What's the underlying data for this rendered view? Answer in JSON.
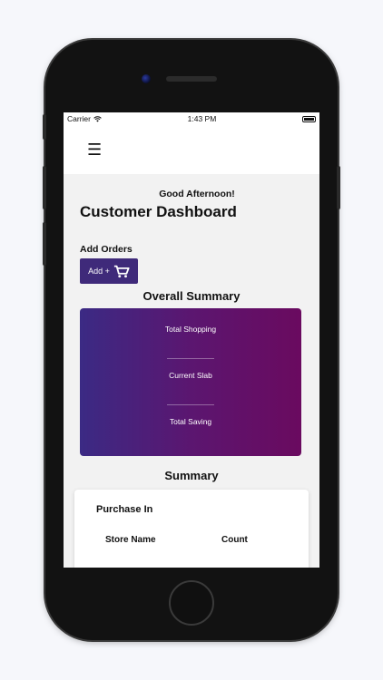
{
  "status_bar": {
    "carrier": "Carrier",
    "time": "1:43 PM"
  },
  "app_bar": {
    "menu_icon": "hamburger-icon"
  },
  "header": {
    "greeting": "Good Afternoon!",
    "title": "Customer Dashboard"
  },
  "orders": {
    "label": "Add Orders",
    "button_label": "Add +",
    "button_icon": "cart-icon"
  },
  "overall_summary": {
    "title": "Overall Summary",
    "metrics": [
      "Total Shopping",
      "Current Slab",
      "Total Saving"
    ],
    "gradient": [
      "#3b2a84",
      "#6a0a5f"
    ]
  },
  "summary": {
    "title": "Summary",
    "panel_title": "Purchase In",
    "columns": [
      "Store Name",
      "Count"
    ]
  },
  "colors": {
    "accent": "#3f2a7a",
    "background": "#f2f2f2"
  }
}
